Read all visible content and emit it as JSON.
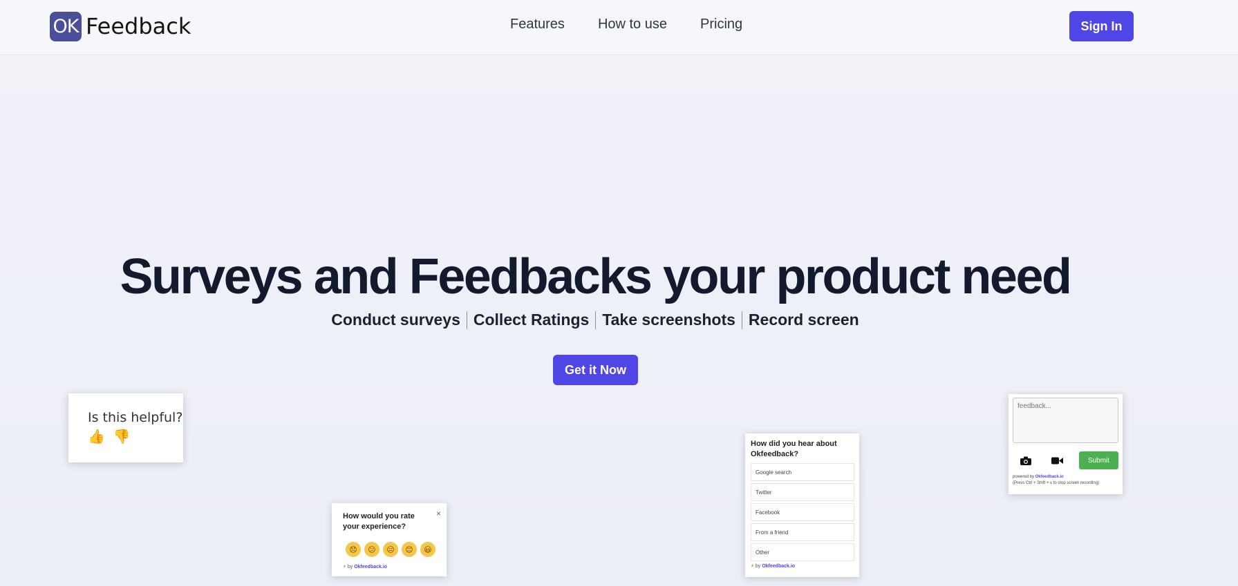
{
  "header": {
    "logo_mark": "OK",
    "logo_text": "Feedback",
    "nav": [
      "Features",
      "How to use",
      "Pricing"
    ],
    "signin_label": "Sign In"
  },
  "hero": {
    "title": "Surveys and Feedbacks your product need",
    "features": [
      "Conduct surveys",
      "Collect Ratings",
      "Take screenshots",
      "Record screen"
    ],
    "cta_label": "Get it Now"
  },
  "widgets": {
    "helpful": {
      "question": "Is this helpful?",
      "up_icon": "thumbs-up-icon",
      "down_icon": "thumbs-down-icon"
    },
    "rating": {
      "question": "How would you rate your experience?",
      "close": "×",
      "emojis": [
        "😞",
        "😕",
        "😐",
        "😊",
        "😃"
      ],
      "powered_prefix": "⚡ by",
      "powered_brand": "Okfeedback.io"
    },
    "hear": {
      "question": "How did you hear about Okfeedback?",
      "options": [
        "Google search",
        "Twitter",
        "Facebook",
        "From a friend",
        "Other"
      ],
      "powered_prefix": "⚡ by",
      "powered_brand": "Okfeedback.io"
    },
    "feedback": {
      "placeholder": "feedback...",
      "camera_icon": "camera-icon",
      "video_icon": "video-icon",
      "submit_label": "Submit",
      "powered_prefix": "powered by",
      "powered_brand": "Okfeedback.io",
      "hint": "(Press Ctrl + Shift + s to stop screen recording)"
    }
  },
  "colors": {
    "brand": "#4f46e5",
    "logo": "#4b4f9a",
    "submit": "#4caf50"
  }
}
